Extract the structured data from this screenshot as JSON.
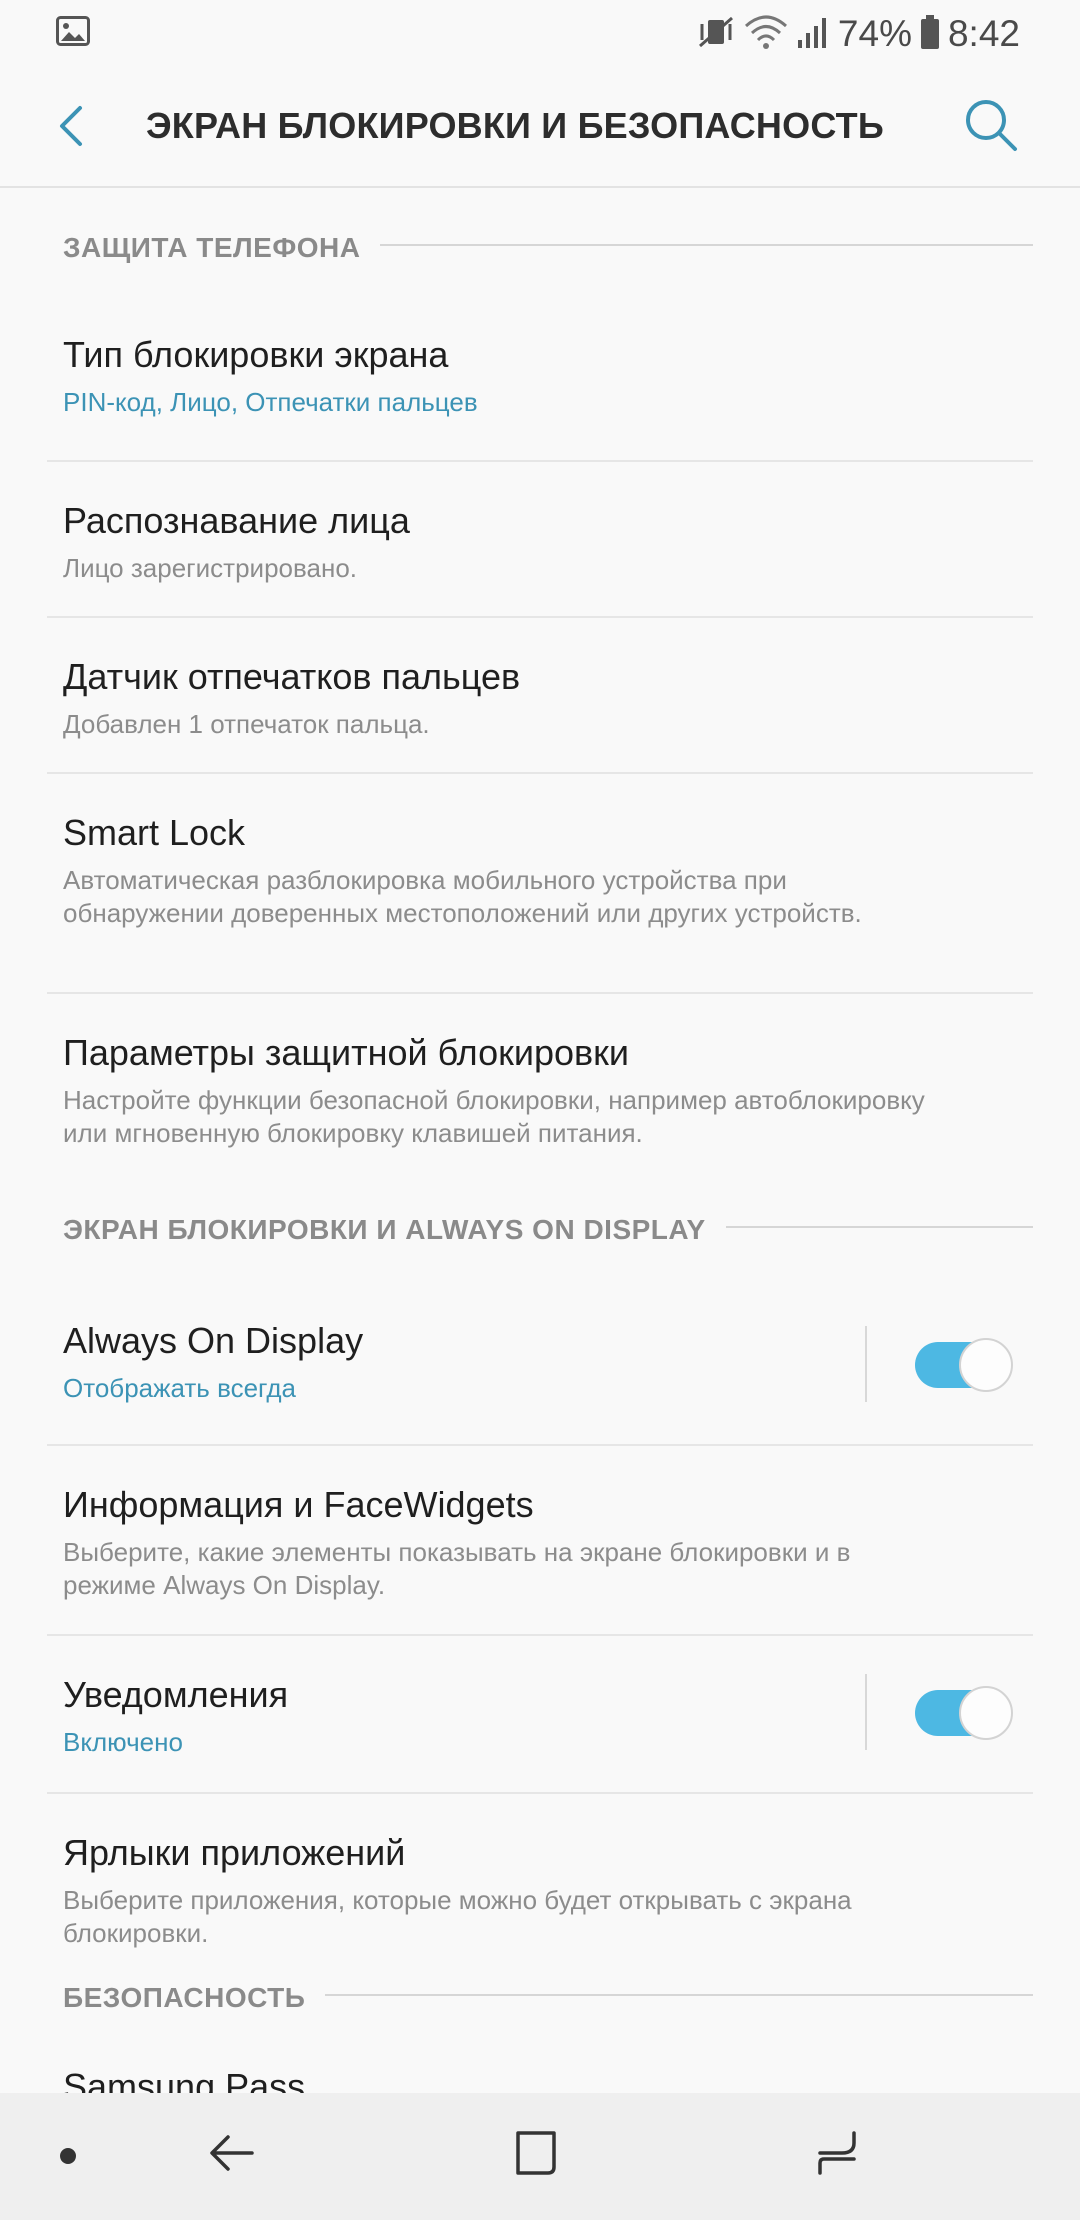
{
  "status_bar": {
    "battery_percent": "74%",
    "time": "8:42",
    "icons": [
      "image-icon",
      "vibrate-icon",
      "wifi-icon",
      "signal-icon",
      "battery-icon"
    ]
  },
  "app_bar": {
    "title": "ЭКРАН БЛОКИРОВКИ И БЕЗОПАСНОСТЬ",
    "icons": [
      "back-icon",
      "search-icon"
    ]
  },
  "sections": [
    {
      "header": "ЗАЩИТА ТЕЛЕФОНА"
    },
    {
      "header": "ЭКРАН БЛОКИРОВКИ И ALWAYS ON DISPLAY"
    },
    {
      "header": "БЕЗОПАСНОСТЬ"
    }
  ],
  "items": [
    {
      "title": "Тип блокировки экрана",
      "subtitle": "PIN-код, Лицо, Отпечатки пальцев"
    },
    {
      "title": "Распознавание лица",
      "subtitle": "Лицо зарегистрировано."
    },
    {
      "title": "Датчик отпечатков пальцев",
      "subtitle": "Добавлен 1 отпечаток пальца."
    },
    {
      "title": "Smart Lock",
      "subtitle": "Автоматическая разблокировка мобильного устройства при обнаружении доверенных местоположений или других устройств."
    },
    {
      "title": "Параметры защитной блокировки",
      "subtitle": "Настройте функции безопасной блокировки, например автоблокировку или мгновенную блокировку клавишей питания."
    },
    {
      "title": "Always On Display",
      "subtitle": "Отображать всегда",
      "toggle_on": true
    },
    {
      "title": "Информация и FaceWidgets",
      "subtitle": "Выберите, какие элементы показывать на экране блокировки и в режиме Always On Display."
    },
    {
      "title": "Уведомления",
      "subtitle": "Включено",
      "toggle_on": true
    },
    {
      "title": "Ярлыки приложений",
      "subtitle": "Выберите приложения, которые можно будет открывать с экрана блокировки."
    },
    {
      "title": "Samsung Pass"
    }
  ],
  "colors": {
    "accent": "#3c93b5",
    "toggle_on": "#4db8e3",
    "background": "#f9f9f9"
  },
  "nav_bar": {
    "icons": [
      "nav-dot-icon",
      "back-arrow-icon",
      "home-icon",
      "recents-icon"
    ]
  }
}
